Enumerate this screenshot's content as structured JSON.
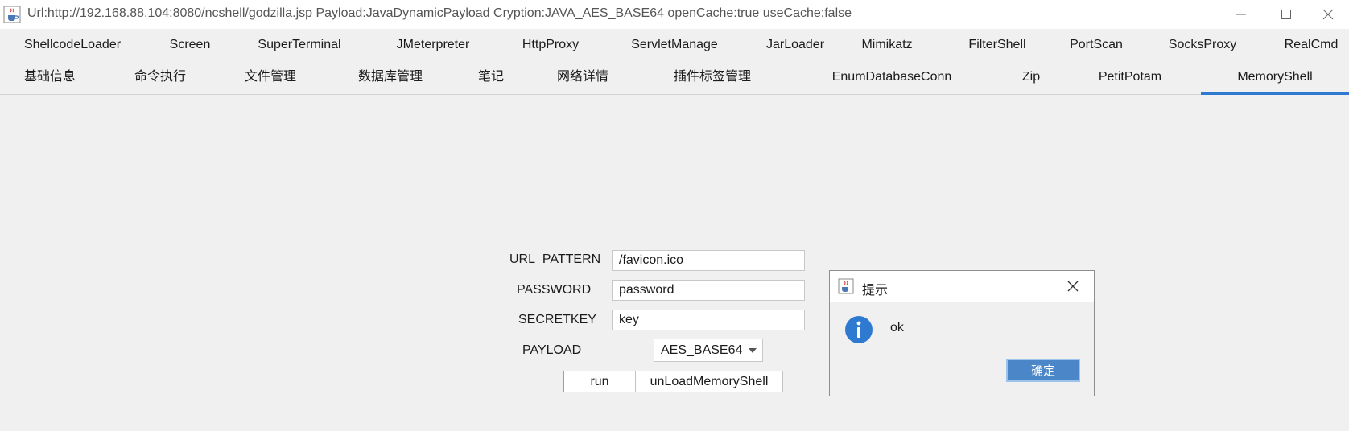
{
  "window": {
    "title": "Url:http://192.168.88.104:8080/ncshell/godzilla.jsp Payload:JavaDynamicPayload Cryption:JAVA_AES_BASE64 openCache:true useCache:false",
    "icons": {
      "app": "java-cup-icon",
      "minimize": "minimize-icon",
      "maximize": "maximize-icon",
      "close": "close-icon"
    }
  },
  "tabs_row1": [
    "ShellcodeLoader",
    "Screen",
    "SuperTerminal",
    "JMeterpreter",
    "HttpProxy",
    "ServletManage",
    "JarLoader",
    "Mimikatz",
    "FilterShell",
    "PortScan",
    "SocksProxy",
    "RealCmd"
  ],
  "tabs_row2": [
    "基础信息",
    "命令执行",
    "文件管理",
    "数据库管理",
    "笔记",
    "网络详情",
    "插件标签管理",
    "EnumDatabaseConn",
    "Zip",
    "PetitPotam",
    "MemoryShell"
  ],
  "active_tab": "MemoryShell",
  "form": {
    "url_pattern_label": "URL_PATTERN",
    "url_pattern_value": "/favicon.ico",
    "password_label": "PASSWORD",
    "password_value": "password",
    "secretkey_label": "SECRETKEY",
    "secretkey_value": "key",
    "payload_label": "PAYLOAD",
    "payload_value": "AES_BASE64",
    "run_label": "run",
    "unload_label": "unLoadMemoryShell"
  },
  "dialog": {
    "title": "提示",
    "message": "ok",
    "ok_label": "确定",
    "info_icon": "info-icon"
  },
  "colors": {
    "accent": "#2f7ad1",
    "dialog_button": "#4a86c8",
    "info_icon": "#2f7ad1"
  }
}
